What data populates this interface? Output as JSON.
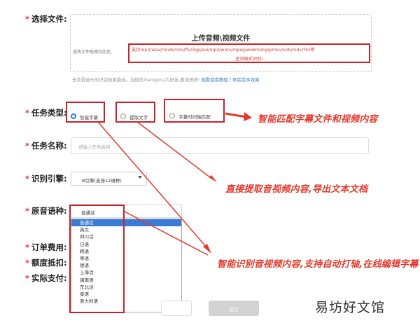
{
  "form": {
    "file_label": "选择文件:",
    "type_label": "任务类型:",
    "name_label": "任务名称:",
    "engine_label": "识别引擎:",
    "lang_label": "原音语种:",
    "order_label": "订单费用:",
    "quota_label": "额度抵扣:",
    "pay_label": "实际支付:"
  },
  "upload": {
    "title": "上传音频\\视频文件",
    "hint": "或将文件拖拽到此处,",
    "formats_line1": "支持mp3/wav/rmvb/mov/flv/3gp/avi/mp4/wmv/mpeg/webm/mpg/mkv/vob/m4v/f4v等",
    "formats_line2": "主流格式识别!"
  },
  "note": {
    "text": "无背景音乐的识别效果最佳。加微信xiangpica为好友,邀请进群!",
    "link": "观看使用教程 / 体验范本效果"
  },
  "task_type": {
    "options": [
      "智能字幕",
      "提取文字",
      "字幕时间轴匹配"
    ],
    "selected": 0
  },
  "task_name": {
    "placeholder": "请输入任务名称"
  },
  "engine": {
    "value": "B引擎(支持12语种)"
  },
  "language": {
    "value": "普通话",
    "options": [
      "普通话",
      "英文",
      "四川话",
      "日语",
      "韩语",
      "粤语",
      "德语",
      "上海话",
      "闽南语",
      "东北话",
      "泰语",
      "意大利语"
    ],
    "highlighted": 0
  },
  "submit": {
    "label": "提交"
  },
  "annotations": {
    "a1": "智能匹配字幕文件和视频内容",
    "a2": "直接提取音视频内容,导出文本文档",
    "a3": "智能识别音视频内容,支持自动打轴,在线编辑字幕"
  },
  "watermark": "易坊好文馆",
  "colors": {
    "annotation_red": "#e23b2e",
    "frame_red": "#c8232c",
    "accent_blue": "#2f7de1"
  }
}
